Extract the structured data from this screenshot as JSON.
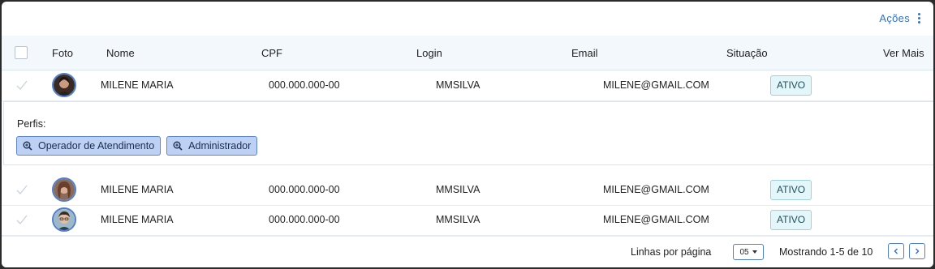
{
  "toolbar": {
    "actions_label": "Ações"
  },
  "table": {
    "columns": {
      "photo": "Foto",
      "name": "Nome",
      "cpf": "CPF",
      "login": "Login",
      "email": "Email",
      "status": "Situação",
      "more": "Ver Mais"
    },
    "rows": [
      {
        "name": "MILENE MARIA",
        "cpf": "000.000.000-00",
        "login": "MMSILVA",
        "email": "MILENE@GMAIL.COM",
        "status": "ATIVO"
      },
      {
        "name": "MILENE MARIA",
        "cpf": "000.000.000-00",
        "login": "MMSILVA",
        "email": "MILENE@GMAIL.COM",
        "status": "ATIVO"
      },
      {
        "name": "MILENE MARIA",
        "cpf": "000.000.000-00",
        "login": "MMSILVA",
        "email": "MILENE@GMAIL.COM",
        "status": "ATIVO"
      }
    ],
    "detail": {
      "label": "Perfis:",
      "profiles": [
        "Operador de Atendimento",
        "Administrador"
      ]
    }
  },
  "pagination": {
    "rows_per_page_label": "Linhas por página",
    "rows_per_page_value": "05",
    "showing_text": "Mostrando 1-5 de 10"
  },
  "colors": {
    "accent": "#2f6fd6",
    "badge_bg": "#e3f6f9",
    "chip_bg": "#bcd1f3"
  }
}
